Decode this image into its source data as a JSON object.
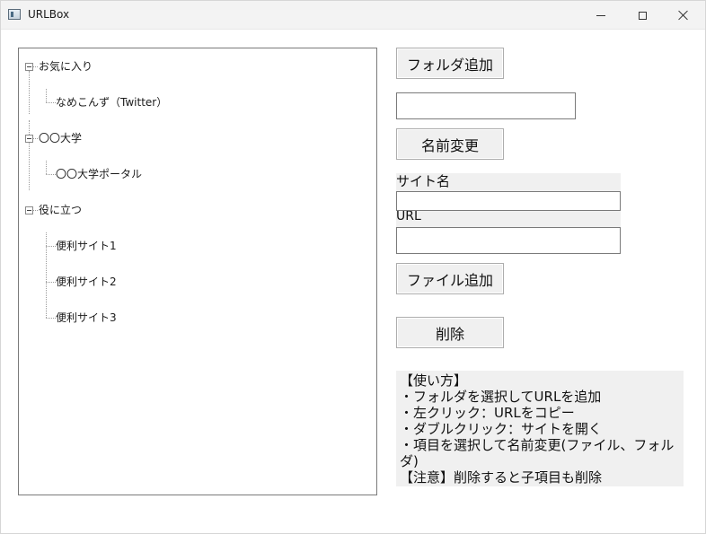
{
  "window": {
    "title": "URLBox"
  },
  "tree": {
    "folders": [
      {
        "label": "お気に入り",
        "children": [
          "なめこんず（Twitter）"
        ]
      },
      {
        "label": "〇〇大学",
        "children": [
          "〇〇大学ポータル"
        ]
      },
      {
        "label": "役に立つ",
        "children": [
          "便利サイト1",
          "便利サイト2",
          "便利サイト3"
        ]
      }
    ]
  },
  "controls": {
    "add_folder_label": "フォルダ追加",
    "rename_input_value": "",
    "rename_label": "名前変更",
    "site_name_label": "サイト名",
    "site_name_value": "",
    "url_label": "URL",
    "url_value": "",
    "add_file_label": "ファイル追加",
    "delete_label": "削除"
  },
  "help": {
    "lines": [
      "【使い方】",
      "・フォルダを選択してURLを追加",
      "・左クリック：URLをコピー",
      "・ダブルクリック：サイトを開く",
      "・項目を選択して名前変更(ファイル、フォルダ)",
      "【注意】削除すると子項目も削除"
    ]
  },
  "colors": {
    "button_bg": "#f0f0f0",
    "label_bg": "#f0f0f0",
    "border": "#7a7a7a"
  }
}
